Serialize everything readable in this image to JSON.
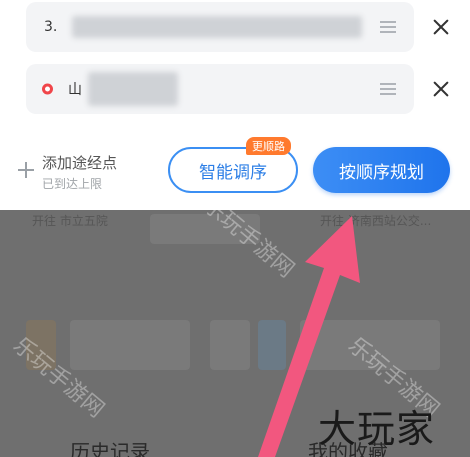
{
  "stops": {
    "row1_label": "3.",
    "row2_label": "山"
  },
  "add_waypoint": {
    "title": "添加途经点",
    "subtitle": "已到达上限"
  },
  "buttons": {
    "smart_order": "智能调序",
    "smart_order_badge": "更顺路",
    "sequential_plan": "按顺序规划"
  },
  "background": {
    "item1": "开往 市立五院",
    "item2": "开往 济南西站公交...",
    "tab_history": "历史记录",
    "tab_favorites": "我的收藏"
  },
  "watermarks": {
    "text1": "乐玩手游网",
    "text2": "乐玩手游网",
    "text3": "乐玩手游网"
  },
  "brand": "大玩家",
  "colors": {
    "accent_blue": "#1f74ec",
    "badge_orange": "#ff7a2e",
    "endpoint_red": "#f0454a",
    "arrow_pink": "#f2577f"
  }
}
